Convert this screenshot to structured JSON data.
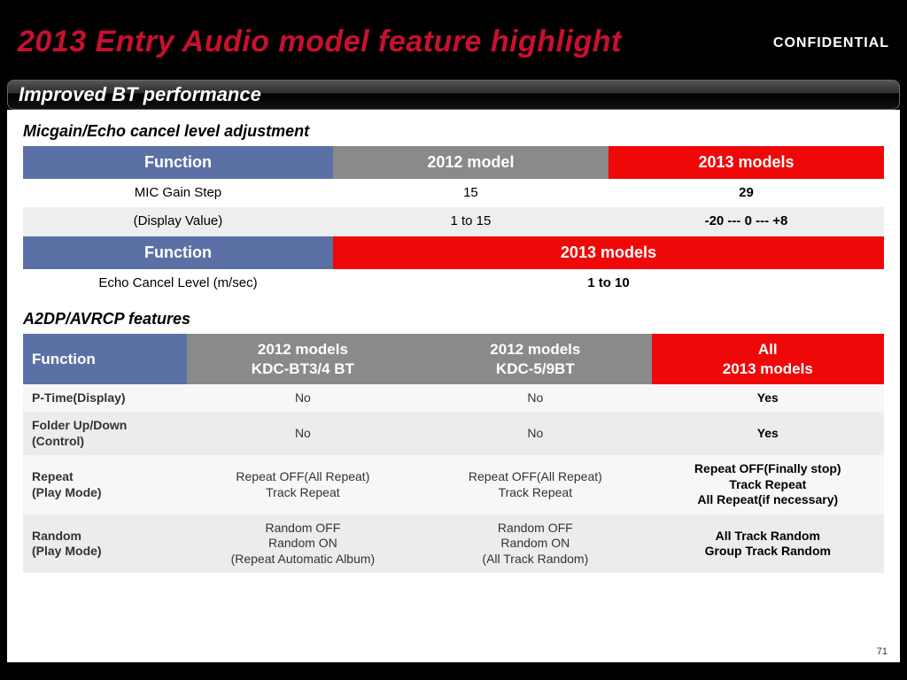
{
  "header": {
    "title": "2013 Entry Audio model feature highlight",
    "confidential": "CONFIDENTIAL",
    "subtitle": "Improved BT performance"
  },
  "section1": {
    "heading": "Micgain/Echo cancel level adjustment",
    "table1": {
      "headers": [
        "Function",
        "2012 model",
        "2013 models"
      ],
      "rows": [
        [
          "MIC Gain Step",
          "15",
          "29"
        ],
        [
          "(Display Value)",
          "1 to 15",
          "-20 --- 0 --- +8"
        ]
      ]
    },
    "table2": {
      "headers": [
        "Function",
        "2013 models"
      ],
      "rows": [
        [
          "Echo Cancel Level (m/sec)",
          "1 to 10"
        ]
      ]
    }
  },
  "section2": {
    "heading": "A2DP/AVRCP features",
    "headers": {
      "0": "Function",
      "1a": "2012 models",
      "1b": "KDC-BT3/4 BT",
      "2a": "2012 models",
      "2b": "KDC-5/9BT",
      "3a": "All",
      "3b": "2013 models"
    },
    "rows": [
      {
        "fn": "P-Time(Display)",
        "c1": "No",
        "c2": "No",
        "c3": "Yes"
      },
      {
        "fn1": "Folder Up/Down",
        "fn2": "(Control)",
        "c1": "No",
        "c2": "No",
        "c3": "Yes"
      },
      {
        "fn1": "Repeat",
        "fn2": "(Play Mode)",
        "c1a": "Repeat OFF(All Repeat)",
        "c1b": "Track Repeat",
        "c2a": "Repeat OFF(All Repeat)",
        "c2b": "Track Repeat",
        "c3a": "Repeat OFF(Finally stop)",
        "c3b": "Track Repeat",
        "c3c": "All Repeat(if necessary)"
      },
      {
        "fn1": "Random",
        "fn2": "(Play Mode)",
        "c1a": "Random OFF",
        "c1b": "Random ON",
        "c1c": "(Repeat Automatic Album)",
        "c2a": "Random OFF",
        "c2b": "Random ON",
        "c2c": "(All Track Random)",
        "c3a": "All Track Random",
        "c3b": "Group Track Random"
      }
    ]
  },
  "footer": {
    "page": "71"
  }
}
